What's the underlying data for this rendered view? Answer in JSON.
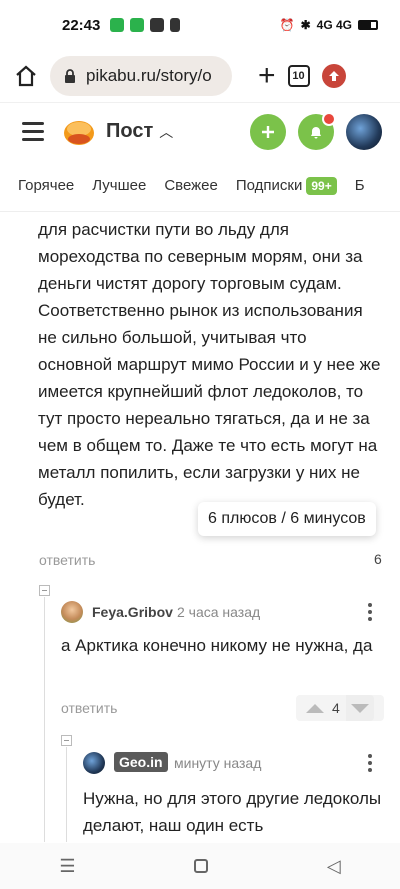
{
  "status": {
    "time": "22:43",
    "network": "4G 4G"
  },
  "browser": {
    "url": "pikabu.ru/story/o",
    "tabs": "10"
  },
  "header": {
    "title": "Пост"
  },
  "tabs": [
    "Горячее",
    "Лучшее",
    "Свежее",
    "Подписки",
    "Б"
  ],
  "subs_badge": "99+",
  "comment1": {
    "text": "для расчистки пути во льду для мореходства по северным морям, они за деньги чистят дорогу торговым судам. Соответственно рынок из использования не сильно большой, учитывая что основной маршрут мимо России и у нее же имеется крупнейший флот ледоколов, то тут просто нереально тягаться, да и не за чем в общем то. Даже те что есть могут на металл попилить, если загрузки у них не будет.",
    "reply": "ответить",
    "rating": "6",
    "tooltip": "6 плюсов / 6 минусов"
  },
  "comment2": {
    "user": "Feya.Gribov",
    "time": "2 часа назад",
    "text": "а Арктика конечно никому не нужна, да",
    "reply": "ответить",
    "rating": "4"
  },
  "comment3": {
    "user": "Geo.in",
    "time": "минуту назад",
    "text": "Нужна, но для этого другие ледоколы делают, наш один есть"
  }
}
